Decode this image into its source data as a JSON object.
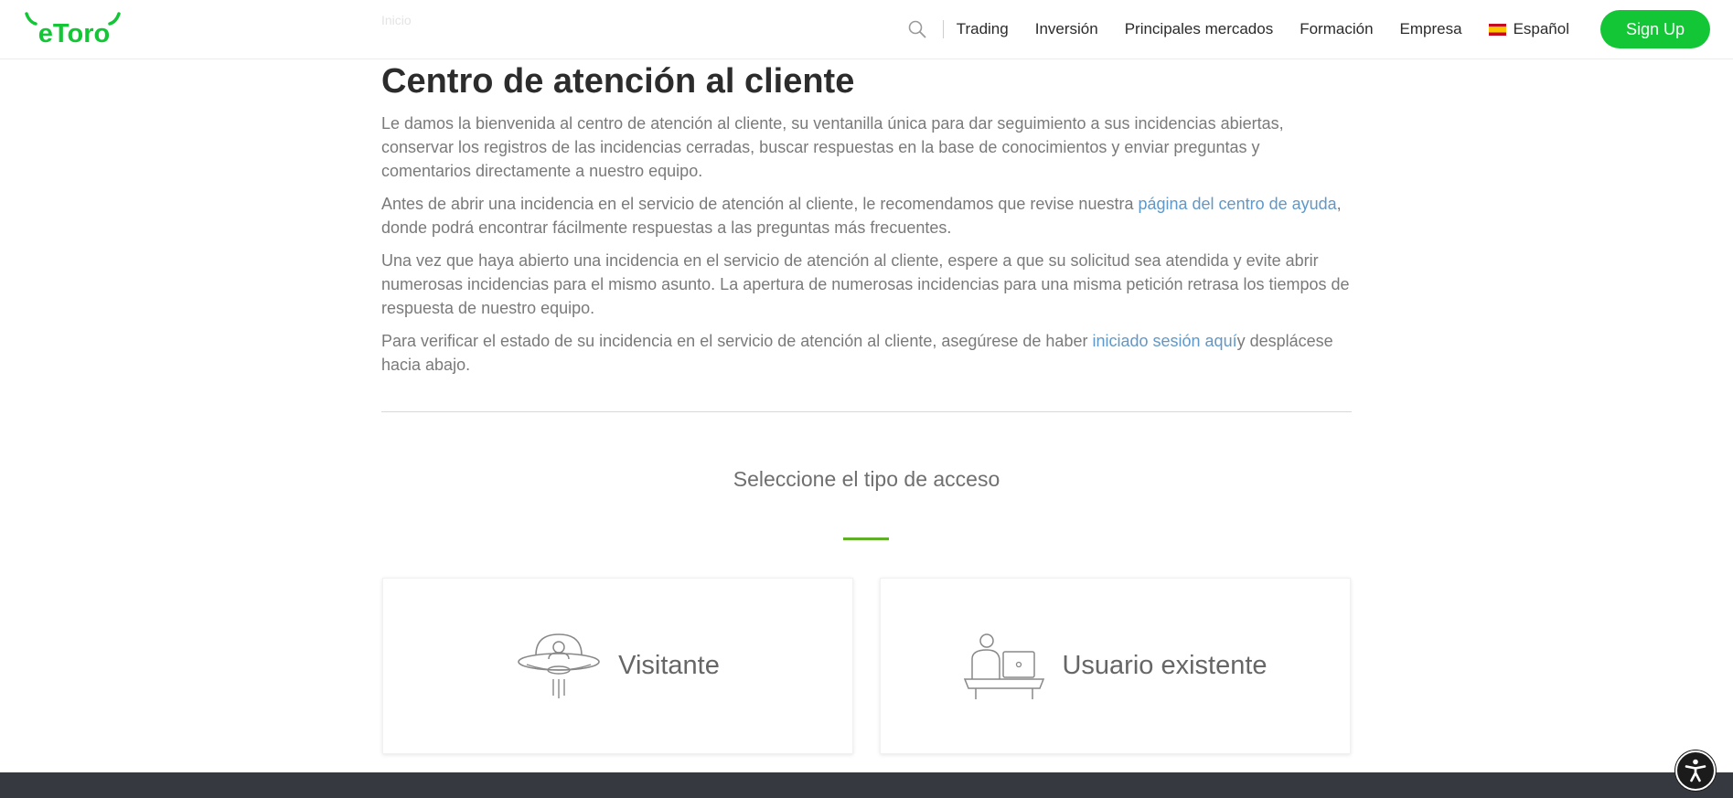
{
  "header": {
    "logo_text": "eToro",
    "nav": [
      "Trading",
      "Inversión",
      "Principales mercados",
      "Formación",
      "Empresa"
    ],
    "language": "Español",
    "signup_label": "Sign Up",
    "brand_color": "#13c636",
    "search_icon": "search-icon",
    "flag_icon": "spain-flag-icon"
  },
  "breadcrumb": "Inicio",
  "main": {
    "title": "Centro de atención al cliente",
    "para1": "Le damos la bienvenida al centro de atención al cliente, su ventanilla única para dar seguimiento a sus incidencias abiertas, conservar los registros de las incidencias cerradas, buscar respuestas en la base de conocimientos y enviar preguntas y comentarios directamente a nuestro equipo.",
    "para2_pre": "Antes de abrir una incidencia en el servicio de atención al cliente, le recomendamos que revise nuestra ",
    "para2_link": "página del centro de ayuda",
    "para2_post": ", donde podrá encontrar fácilmente respuestas a las preguntas más frecuentes.",
    "para3": "Una vez que haya abierto una incidencia en el servicio de atención al cliente, espere a que su solicitud sea atendida y evite abrir numerosas incidencias para el mismo asunto. La apertura de numerosas incidencias para una misma petición retrasa los tiempos de respuesta de nuestro equipo.",
    "para4_pre": "Para verificar el estado de su incidencia en el servicio de atención al cliente, asegúrese de haber ",
    "para4_link": "iniciado sesión aquí",
    "para4_post": "y desplácese hacia abajo.",
    "link_color": "#5f98c9"
  },
  "access": {
    "title": "Seleccione el tipo de acceso",
    "accent_color": "#5fb026",
    "visitor_label": "Visitante",
    "visitor_icon": "ufo-visitor-icon",
    "existing_label": "Usuario existente",
    "existing_icon": "user-laptop-icon"
  },
  "accessibility_icon": "accessibility-icon"
}
